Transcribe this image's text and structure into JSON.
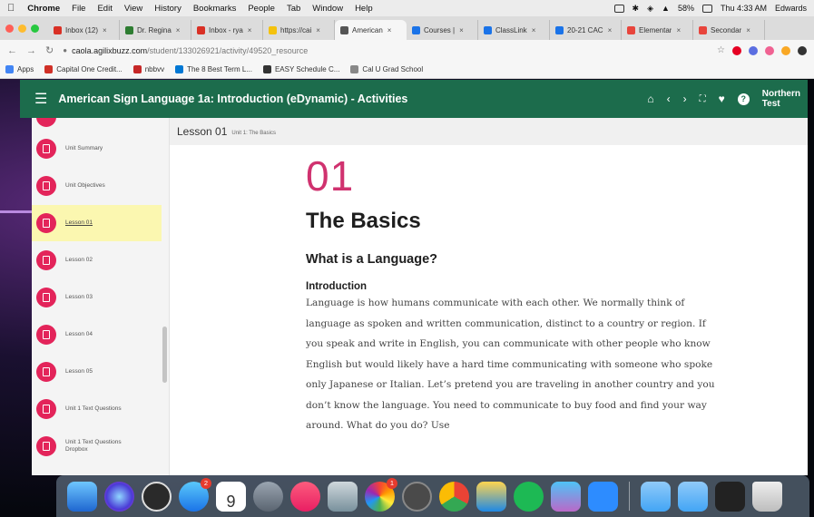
{
  "menubar": {
    "app": "Chrome",
    "items": [
      "File",
      "Edit",
      "View",
      "History",
      "Bookmarks",
      "People",
      "Tab",
      "Window",
      "Help"
    ],
    "battery": "58%",
    "clock": "Thu 4:33 AM",
    "user": "Edwards"
  },
  "tabs": [
    {
      "label": "Inbox (12)",
      "color": "#d93025"
    },
    {
      "label": "Dr. Regina",
      "color": "#2e7d32"
    },
    {
      "label": "Inbox - rya",
      "color": "#d93025"
    },
    {
      "label": "https://cai",
      "color": "#f4c20d"
    },
    {
      "label": "American",
      "color": "#555555"
    },
    {
      "label": "Courses |",
      "color": "#1a73e8"
    },
    {
      "label": "ClassLink",
      "color": "#1a73e8"
    },
    {
      "label": "20-21 CAC",
      "color": "#1a73e8"
    },
    {
      "label": "Elementar",
      "color": "#e8453c"
    },
    {
      "label": "Secondar",
      "color": "#e8453c"
    }
  ],
  "active_tab_index": 4,
  "address": {
    "domain": "caola.agilixbuzz.com",
    "path": "/student/133026921/activity/49520_resource"
  },
  "bookmarks": [
    {
      "label": "Apps",
      "color": "#4285f4"
    },
    {
      "label": "Capital One Credit...",
      "color": "#d03027"
    },
    {
      "label": "nbbvv",
      "color": "#c62828"
    },
    {
      "label": "The 8 Best Term L...",
      "color": "#0078d4"
    },
    {
      "label": "EASY Schedule C...",
      "color": "#333333"
    },
    {
      "label": "Cal U Grad School",
      "color": "#888888"
    }
  ],
  "header": {
    "title": "American Sign Language 1a: Introduction (eDynamic) - Activities",
    "user_line1": "Northern",
    "user_line2": "Test",
    "bg": "#1c6c4c"
  },
  "sidebar": {
    "items": [
      {
        "label": "Unit Summary"
      },
      {
        "label": "Unit Objectives"
      },
      {
        "label": "Lesson 01"
      },
      {
        "label": "Lesson 02"
      },
      {
        "label": "Lesson 03"
      },
      {
        "label": "Lesson 04"
      },
      {
        "label": "Lesson 05"
      },
      {
        "label": "Unit 1 Text Questions"
      },
      {
        "label": "Unit 1 Text Questions Dropbox"
      }
    ],
    "active_index": 2,
    "badge_color": "#e3245a"
  },
  "main": {
    "lesson_title": "Lesson 01",
    "lesson_sub": "Unit 1: The Basics",
    "number": "01",
    "heading": "The Basics",
    "subheading": "What is a Language?",
    "section": "Introduction",
    "paragraph": "Language is how humans communicate with each other. We normally think of language as spoken and written communication, distinct to a country or region. If you speak and write in English, you can communicate with other people who know English but would likely have a hard time communicating with someone who spoke only Japanese or Italian. Let’s pretend you are traveling in another country and you don’t know the language. You need to communicate to buy food and find your way around. What do you do? Use"
  },
  "dock": {
    "calendar_day": "9",
    "appstore_badge": "2",
    "photos_badge": "1"
  }
}
